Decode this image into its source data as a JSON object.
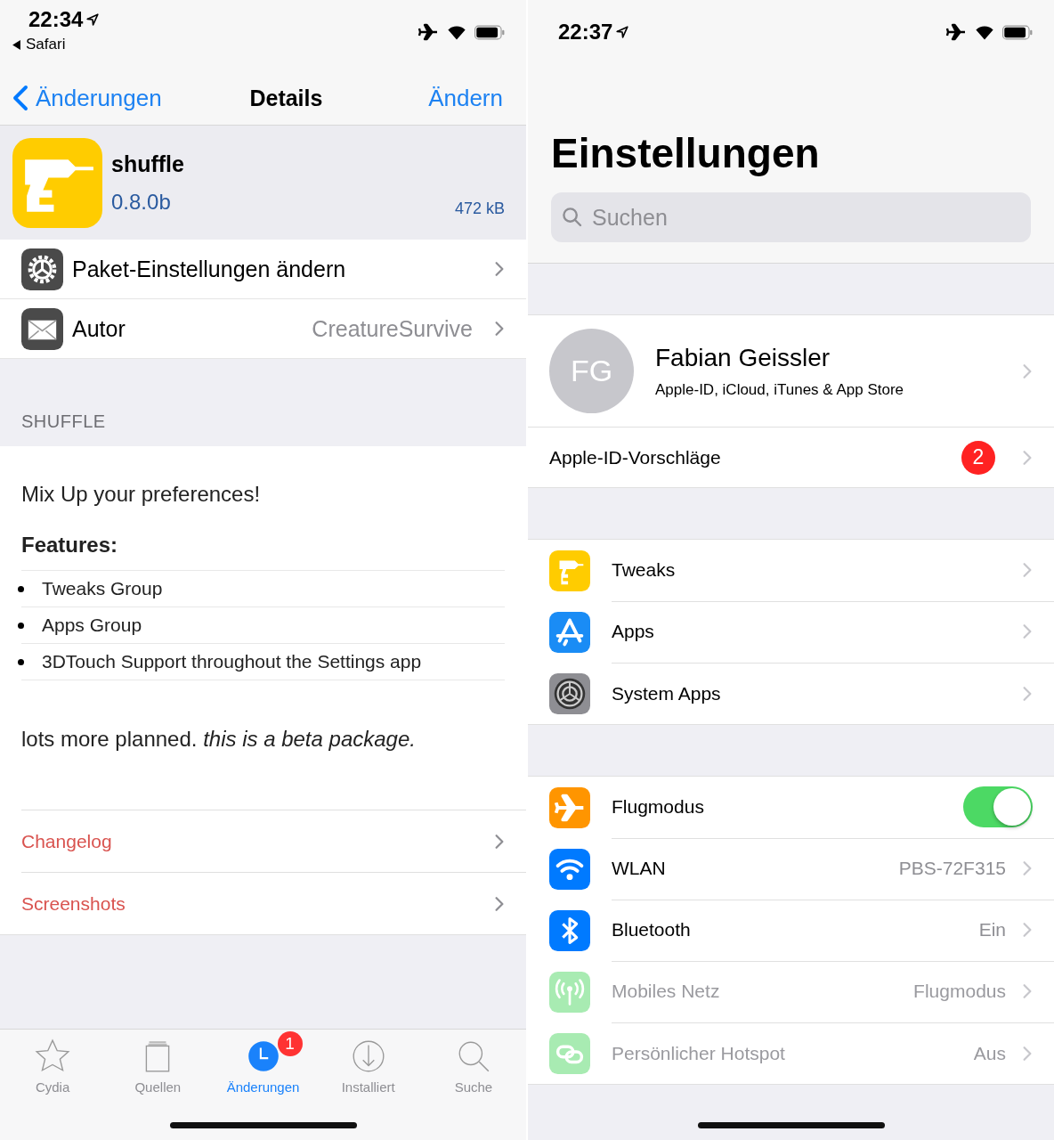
{
  "left": {
    "status_bar": {
      "time": "22:34",
      "back_app": "Safari"
    },
    "nav": {
      "back": "Änderungen",
      "title": "Details",
      "action": "Ändern"
    },
    "package": {
      "name": "shuffle",
      "version": "0.8.0b",
      "size": "472 kB"
    },
    "actions": [
      {
        "label": "Paket-Einstellungen ändern"
      },
      {
        "label": "Autor",
        "value": "CreatureSurvive"
      }
    ],
    "section_header": "SHUFFLE",
    "description": {
      "intro": "Mix Up your preferences!",
      "features_heading": "Features:",
      "features": [
        "Tweaks Group",
        "Apps Group",
        "3DTouch Support throughout the Settings app"
      ],
      "note": "lots more planned. *this is a beta package.*"
    },
    "links": [
      "Changelog",
      "Screenshots"
    ],
    "tab_bar": [
      {
        "label": "Cydia",
        "selected": false
      },
      {
        "label": "Quellen",
        "selected": false
      },
      {
        "label": "Änderungen",
        "selected": true,
        "badge": "1"
      },
      {
        "label": "Installiert",
        "selected": false
      },
      {
        "label": "Suche",
        "selected": false
      }
    ]
  },
  "right": {
    "status_bar": {
      "time": "22:37"
    },
    "title": "Einstellungen",
    "search": {
      "placeholder": "Suchen"
    },
    "account": {
      "initials": "FG",
      "name": "Fabian Geissler",
      "subtitle": "Apple-ID, iCloud, iTunes & App Store"
    },
    "suggestions": {
      "label": "Apple-ID-Vorschläge",
      "badge": "2"
    },
    "groups": [
      [
        {
          "label": "Tweaks",
          "color": "#ffcc00",
          "kind": "link",
          "disabled": false
        },
        {
          "label": "Apps",
          "color": "#1a8cf5",
          "kind": "link",
          "disabled": false
        },
        {
          "label": "System Apps",
          "color": "#8e8e93",
          "kind": "link",
          "disabled": false
        }
      ],
      [
        {
          "label": "Flugmodus",
          "color": "#ff9500",
          "kind": "toggle",
          "on": true,
          "disabled": false
        },
        {
          "label": "WLAN",
          "color": "#007aff",
          "kind": "link",
          "value": "PBS-72F315",
          "disabled": false
        },
        {
          "label": "Bluetooth",
          "color": "#007aff",
          "kind": "link",
          "value": "Ein",
          "disabled": false
        },
        {
          "label": "Mobiles Netz",
          "color": "#a8ebb2",
          "kind": "link",
          "value": "Flugmodus",
          "disabled": true
        },
        {
          "label": "Persönlicher Hotspot",
          "color": "#a8ebb2",
          "kind": "link",
          "value": "Aus",
          "disabled": true
        }
      ]
    ]
  }
}
